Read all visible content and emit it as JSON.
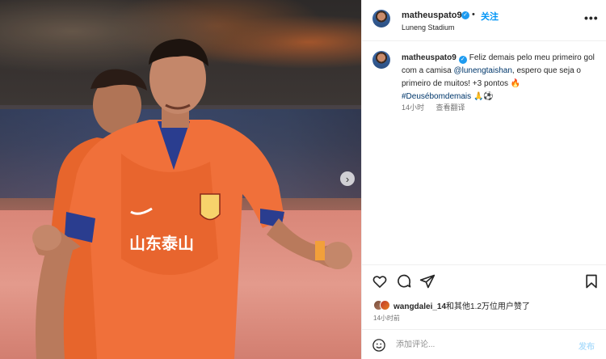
{
  "post": {
    "image": {
      "jersey_text": "山东泰山",
      "description_icon": "soccer-player-photo"
    },
    "header": {
      "username": "matheuspato9",
      "verified_icon": "verified-badge-icon",
      "separator": "•",
      "follow_label": "关注",
      "location": "Luneng Stadium",
      "more_label": "•••"
    },
    "caption": {
      "username": "matheuspato9",
      "text_before_mention": "Feliz demais pelo meu primeiro gol com a camisa ",
      "mention": "@lunengtaishan",
      "text_after_mention": ", espero que seja o primeiro de muitos! +3 pontos 🔥",
      "hashtag": "#Deusébomdemais",
      "emojis_after_hashtag": " 🙏⚽",
      "time": "14小时",
      "translate_label": "查看翻译"
    },
    "actions": {
      "icons": [
        "heart-icon",
        "comment-icon",
        "share-icon",
        "bookmark-icon"
      ]
    },
    "likes": {
      "user": "wangdalei_14",
      "rest": "和其他1.2万位用户赞了"
    },
    "time_ago": "14小时前",
    "comment": {
      "placeholder": "添加评论...",
      "post_label": "发布"
    }
  },
  "colors": {
    "accent": "#0095f6",
    "verified": "#1d9bf0",
    "link": "#00376b",
    "jersey": "#f0703a"
  }
}
